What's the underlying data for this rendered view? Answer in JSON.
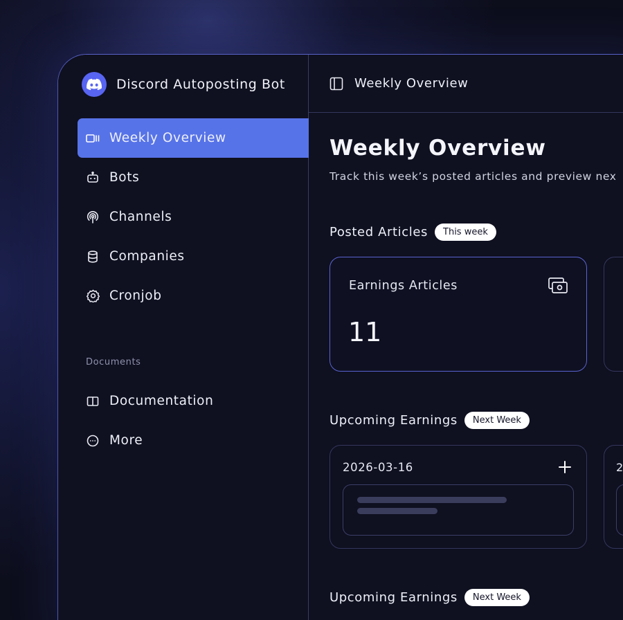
{
  "app": {
    "name": "Discord Autoposting Bot",
    "logo_icon": "discord-icon",
    "brand_color": "#5865f2",
    "accent_color": "#5773e8"
  },
  "sidebar": {
    "items": [
      {
        "label": "Weekly Overview",
        "icon": "overview-icon",
        "active": true
      },
      {
        "label": "Bots",
        "icon": "bot-icon"
      },
      {
        "label": "Channels",
        "icon": "broadcast-icon"
      },
      {
        "label": "Companies",
        "icon": "database-icon"
      },
      {
        "label": "Cronjob",
        "icon": "gear-icon"
      }
    ],
    "documents_label": "Documents",
    "doc_items": [
      {
        "label": "Documentation",
        "icon": "book-icon"
      },
      {
        "label": "More",
        "icon": "more-icon"
      }
    ]
  },
  "topbar": {
    "title": "Weekly Overview",
    "toggle_icon": "sidebar-toggle-icon"
  },
  "page": {
    "title": "Weekly Overview",
    "subtitle": "Track this week’s posted articles and preview nex"
  },
  "posted": {
    "title": "Posted Articles",
    "badge": "This week",
    "cards": [
      {
        "title": "Earnings Articles",
        "value": "11",
        "icon": "money-icon"
      }
    ]
  },
  "upcoming": [
    {
      "title": "Upcoming Earnings",
      "badge": "Next Week",
      "date": "2026-03-16",
      "ghost_date": "2"
    },
    {
      "title": "Upcoming Earnings",
      "badge": "Next Week"
    }
  ]
}
